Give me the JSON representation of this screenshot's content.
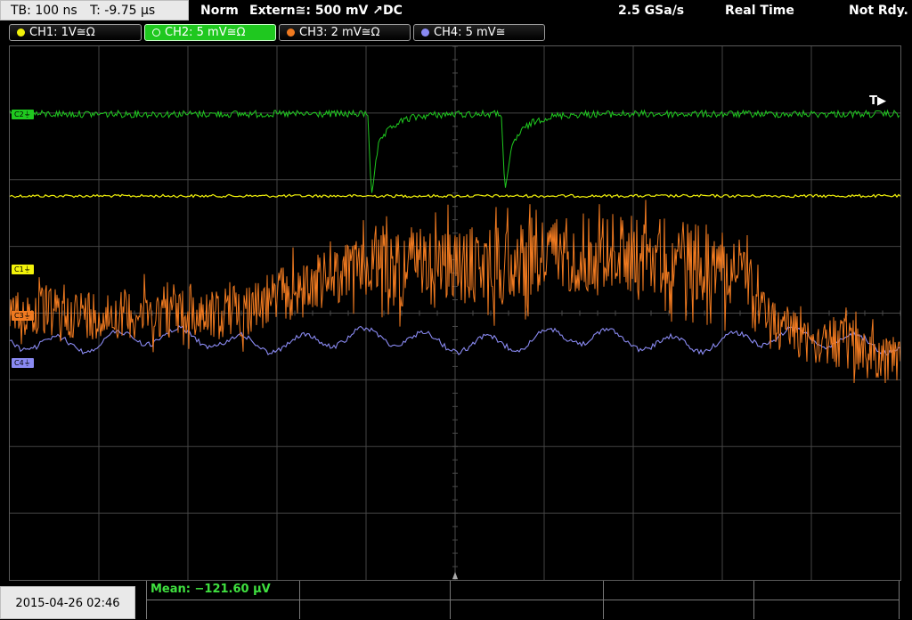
{
  "topbar": {
    "timebase": "TB: 100 ns",
    "trigger_time": "T: -9.75 µs",
    "mode": "Norm",
    "trigger_source": "Extern≅: 500 mV ↗DC",
    "sample_rate": "2.5 GSa/s",
    "acq_mode": "Real Time",
    "state": "Not Rdy."
  },
  "channels": [
    {
      "label": "CH1: 1V≅Ω",
      "color": "#f2f20a"
    },
    {
      "label": "CH2: 5 mV≅Ω",
      "color": "#1fc81f"
    },
    {
      "label": "CH3: 2 mV≅Ω",
      "color": "#f07a20"
    },
    {
      "label": "CH4: 5 mV≅",
      "color": "#8a8af2"
    }
  ],
  "markers": {
    "ch2": "C2⏚",
    "ch1": "C1⏚",
    "ch3": "C3⏚",
    "ch4": "C4⏚"
  },
  "trigger_marker": "T▶",
  "measurement": {
    "mean": "Mean: −121.60 µV"
  },
  "datetime": "2015-04-26  02:46",
  "colors": {
    "ch1": "#f2f20a",
    "ch2": "#1fc81f",
    "ch3": "#f07a20",
    "ch4": "#8a8af2",
    "grid": "#4a4a4a"
  }
}
